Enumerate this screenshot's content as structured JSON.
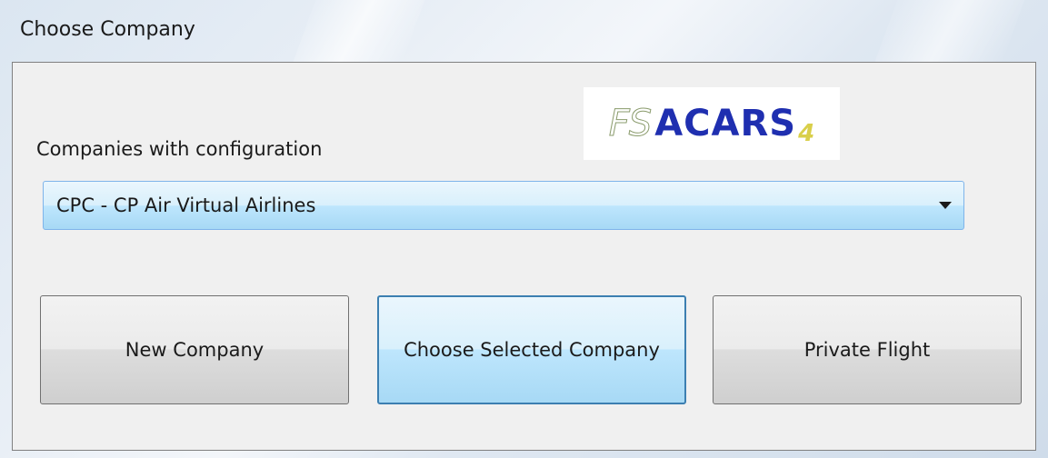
{
  "window": {
    "title": "Choose Company"
  },
  "logo": {
    "fs": "FS",
    "acars": "ACARS",
    "version": "4"
  },
  "companies": {
    "label": "Companies with configuration",
    "selected": "CPC - CP Air Virtual Airlines"
  },
  "buttons": {
    "new_company": "New Company",
    "choose_selected": "Choose Selected Company",
    "private_flight": "Private Flight"
  },
  "colors": {
    "accent_border": "#3c7fb1",
    "logo_blue": "#1f2fb0",
    "logo_yellow": "#d9cf4a"
  }
}
